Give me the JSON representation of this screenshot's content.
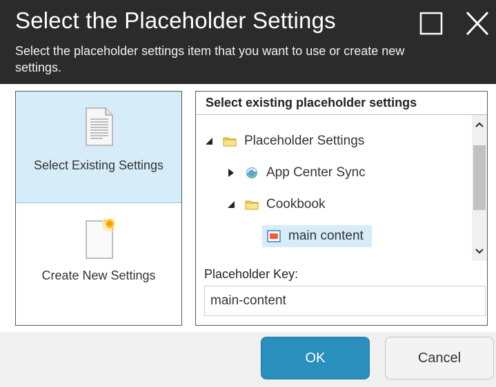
{
  "dialog": {
    "title": "Select the Placeholder Settings",
    "subtitle": "Select the placeholder settings item that you want to use or create new settings."
  },
  "options": [
    {
      "label": "Select Existing Settings",
      "selected": true,
      "icon": "document-icon"
    },
    {
      "label": "Create New Settings",
      "selected": false,
      "icon": "new-document-icon"
    }
  ],
  "panel": {
    "header": "Select existing placeholder settings",
    "tree": [
      {
        "label": "Placeholder Settings",
        "icon": "folder-icon",
        "expanded": true
      },
      {
        "label": "App Center Sync",
        "icon": "sync-icon",
        "expanded": false
      },
      {
        "label": "Cookbook",
        "icon": "folder-icon",
        "expanded": true
      },
      {
        "label": "main content",
        "icon": "placeholder-icon",
        "selected": true
      }
    ],
    "key_label": "Placeholder Key:",
    "key_value": "main-content"
  },
  "buttons": {
    "ok": "OK",
    "cancel": "Cancel"
  },
  "colors": {
    "titlebar": "#2b2b2b",
    "selection": "#d6ecf8",
    "primary_button": "#2a8fbd"
  }
}
